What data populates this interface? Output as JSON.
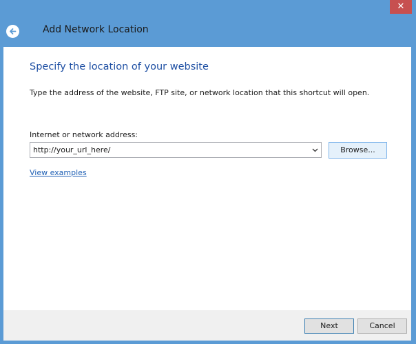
{
  "window": {
    "close_glyph": "✕",
    "header_title": "Add Network Location"
  },
  "content": {
    "title": "Specify the location of your website",
    "instructions": "Type the address of the website, FTP site, or network location that this shortcut will open.",
    "address_label": "Internet or network address:",
    "address_value": "http://your_url_here/",
    "browse_label": "Browse...",
    "view_examples_label": "View examples"
  },
  "footer": {
    "next_label": "Next",
    "cancel_label": "Cancel"
  },
  "icons": {
    "back": "back-arrow-icon",
    "close": "close-icon",
    "dropdown": "chevron-down-icon"
  },
  "colors": {
    "titlebar": "#5b9bd5",
    "close_button": "#c75050",
    "title_accent": "#1e4fa3",
    "link": "#1e5fb4"
  }
}
